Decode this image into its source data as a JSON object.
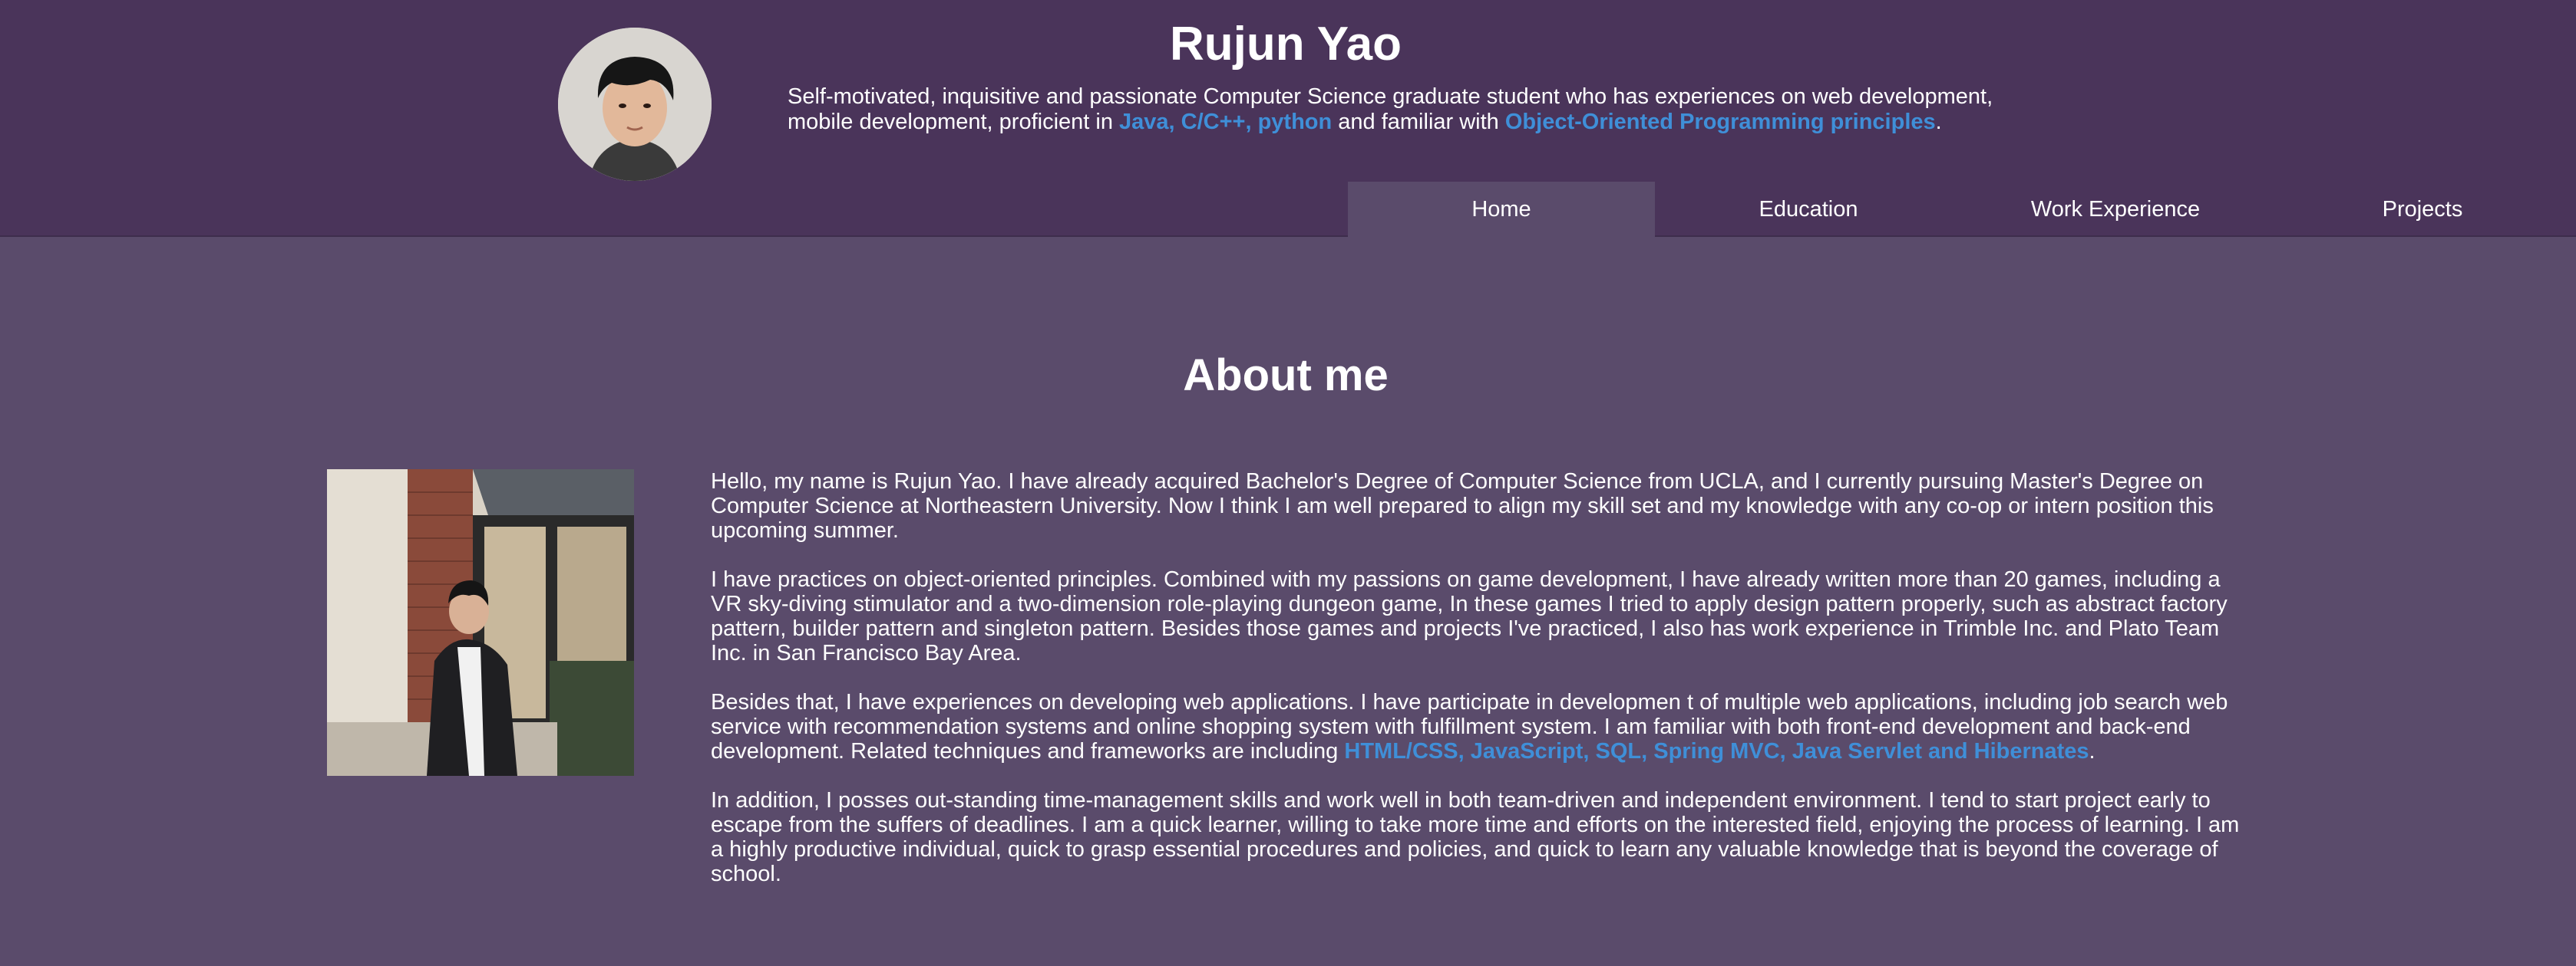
{
  "header": {
    "name": "Rujun Yao",
    "intro": {
      "part1": "Self-motivated, inquisitive and passionate Computer Science graduate student who has experiences on web development, mobile development, proficient in ",
      "highlight1": "Java, C/C++, python",
      "part2": " and familiar with ",
      "highlight2": "Object-Oriented Programming principles",
      "part3": "."
    }
  },
  "nav": {
    "items": [
      {
        "label": "Home"
      },
      {
        "label": "Education"
      },
      {
        "label": "Work Experience"
      },
      {
        "label": "Projects"
      }
    ],
    "active": "Home"
  },
  "about": {
    "title": "About me",
    "p1": "Hello, my name is Rujun Yao. I have already acquired Bachelor's Degree of Computer Science from UCLA, and I currently pursuing Master's Degree on Computer Science at Northeastern University. Now I think I am well prepared to align my skill set and my knowledge with any co-op or intern position this upcoming summer.",
    "p2": "I have practices on object-oriented principles. Combined with my passions on game development, I have already written more than 20 games, including a VR sky-diving stimulator and a two-dimension role-playing dungeon game, In these games I tried to apply design pattern properly, such as abstract factory pattern, builder pattern and singleton pattern. Besides those games and projects I've practiced, I also has work experience in Trimble Inc. and Plato Team Inc. in San Francisco Bay Area.",
    "p3_part1": "Besides that, I have experiences on developing web applications. I have participate in developmen t of multiple web applications, including job search web service with recommendation systems and online shopping system with fulfillment system. I am familiar with both front-end development and back-end development. Related techniques and frameworks are including ",
    "p3_highlight": "HTML/CSS, JavaScript, SQL, Spring MVC, Java Servlet and Hibernates",
    "p3_part2": ".",
    "p4": "In addition, I posses out-standing time-management skills and work well in both team-driven and independent environment. I tend to start project early to escape from the suffers of deadlines. I am a quick learner, willing to take more time and efforts on the interested field, enjoying the process of learning. I am a highly productive individual, quick to grasp essential procedures and policies, and quick to learn any valuable knowledge that is beyond the coverage of school."
  },
  "colors": {
    "header_bg": "#4a345a",
    "page_bg": "#5a4b6b",
    "accent": "#3f8fd8",
    "text": "#ffffff"
  }
}
